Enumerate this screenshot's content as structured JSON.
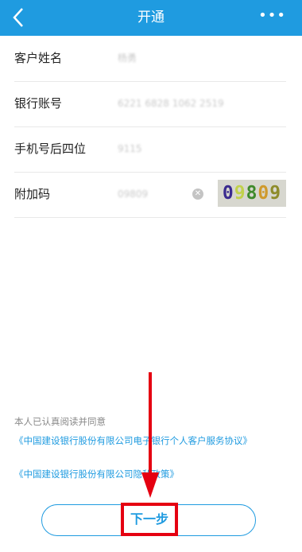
{
  "header": {
    "title": "开通",
    "more": "•••"
  },
  "form": {
    "rows": [
      {
        "label": "客户姓名",
        "value": "杨勇"
      },
      {
        "label": "银行账号",
        "value": "6221 6828 1062 2519"
      },
      {
        "label": "手机号后四位",
        "value": "9115"
      },
      {
        "label": "附加码",
        "value": "09809"
      }
    ],
    "captcha": [
      "0",
      "9",
      "8",
      "0",
      "9"
    ]
  },
  "agreement": {
    "intro": "本人已认真阅读并同意",
    "link1": "《中国建设银行股份有限公司电子银行个人客户服务协议》",
    "link2": "《中国建设银行股份有限公司隐私政策》"
  },
  "buttons": {
    "next": "下一步"
  },
  "colors": {
    "primary": "#1f9be0",
    "highlight": "#e50011"
  }
}
